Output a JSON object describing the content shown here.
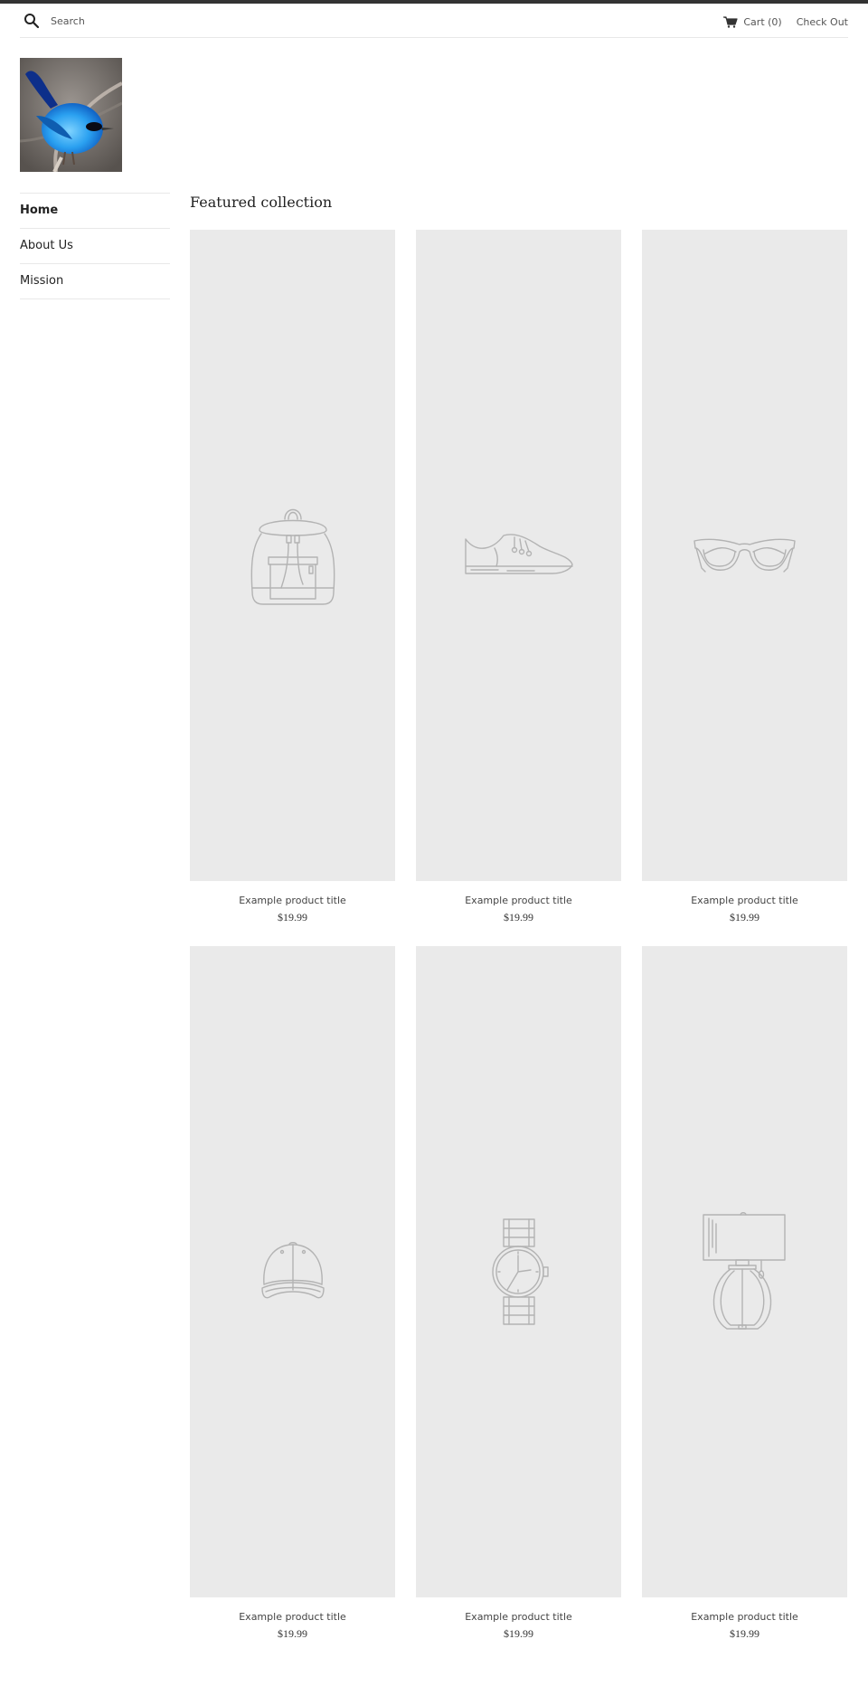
{
  "header": {
    "search_placeholder": "Search",
    "cart_label": "Cart (0)",
    "checkout_label": "Check Out"
  },
  "logo": {
    "alt": "Blue bird logo"
  },
  "sidebar": {
    "items": [
      {
        "label": "Home",
        "active": true
      },
      {
        "label": "About Us",
        "active": false
      },
      {
        "label": "Mission",
        "active": false
      }
    ]
  },
  "main": {
    "section_title": "Featured collection",
    "products": [
      {
        "title": "Example product title",
        "price": "$19.99",
        "icon": "backpack-icon"
      },
      {
        "title": "Example product title",
        "price": "$19.99",
        "icon": "shoe-icon"
      },
      {
        "title": "Example product title",
        "price": "$19.99",
        "icon": "sunglasses-icon"
      },
      {
        "title": "Example product title",
        "price": "$19.99",
        "icon": "cap-icon"
      },
      {
        "title": "Example product title",
        "price": "$19.99",
        "icon": "watch-icon"
      },
      {
        "title": "Example product title",
        "price": "$19.99",
        "icon": "lamp-icon"
      }
    ]
  },
  "colors": {
    "top_border": "#333333",
    "placeholder_bg": "#eaeaea",
    "divider": "#e8e8e8",
    "illustration_stroke": "#b3b3b3"
  }
}
